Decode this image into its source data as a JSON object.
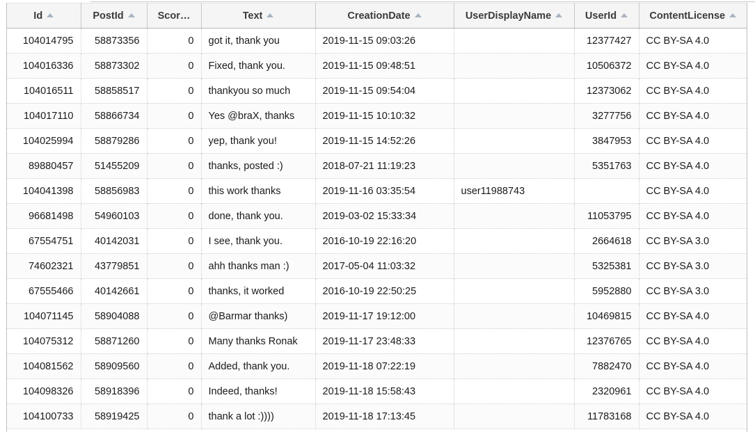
{
  "table": {
    "columns": [
      {
        "key": "id",
        "label": "Id",
        "sort": "asc",
        "align": "a-right",
        "width": 106,
        "truncated": false
      },
      {
        "key": "postid",
        "label": "PostId",
        "sort": "asc",
        "align": "a-right",
        "width": 95,
        "truncated": false
      },
      {
        "key": "score",
        "label": "Scor…",
        "sort": "none",
        "align": "a-right",
        "width": 78,
        "truncated": true
      },
      {
        "key": "text",
        "label": "Text",
        "sort": "asc",
        "align": "a-left",
        "width": 164,
        "truncated": false
      },
      {
        "key": "creationdate",
        "label": "CreationDate",
        "sort": "asc",
        "align": "a-left",
        "width": 199,
        "truncated": false
      },
      {
        "key": "userdisplayname",
        "label": "UserDisplayName",
        "sort": "asc",
        "align": "a-left",
        "width": 173,
        "truncated": false
      },
      {
        "key": "userid",
        "label": "UserId",
        "sort": "asc",
        "align": "a-right",
        "width": 93,
        "truncated": false
      },
      {
        "key": "contentlicense",
        "label": "ContentLicense",
        "sort": "asc",
        "align": "a-left",
        "width": 155,
        "truncated": false
      }
    ],
    "rows": [
      {
        "id": "104014795",
        "postid": "58873356",
        "score": "0",
        "text": "got it, thank you",
        "creationdate": "2019-11-15 09:03:26",
        "userdisplayname": "",
        "userid": "12377427",
        "contentlicense": "CC BY-SA 4.0"
      },
      {
        "id": "104016336",
        "postid": "58873302",
        "score": "0",
        "text": "Fixed, thank you.",
        "creationdate": "2019-11-15 09:48:51",
        "userdisplayname": "",
        "userid": "10506372",
        "contentlicense": "CC BY-SA 4.0"
      },
      {
        "id": "104016511",
        "postid": "58858517",
        "score": "0",
        "text": "thankyou so much",
        "creationdate": "2019-11-15 09:54:04",
        "userdisplayname": "",
        "userid": "12373062",
        "contentlicense": "CC BY-SA 4.0"
      },
      {
        "id": "104017110",
        "postid": "58866734",
        "score": "0",
        "text": "Yes @braX, thanks",
        "creationdate": "2019-11-15 10:10:32",
        "userdisplayname": "",
        "userid": "3277756",
        "contentlicense": "CC BY-SA 4.0"
      },
      {
        "id": "104025994",
        "postid": "58879286",
        "score": "0",
        "text": "yep, thank you!",
        "creationdate": "2019-11-15 14:52:26",
        "userdisplayname": "",
        "userid": "3847953",
        "contentlicense": "CC BY-SA 4.0"
      },
      {
        "id": "89880457",
        "postid": "51455209",
        "score": "0",
        "text": "thanks, posted :)",
        "creationdate": "2018-07-21 11:19:23",
        "userdisplayname": "",
        "userid": "5351763",
        "contentlicense": "CC BY-SA 4.0"
      },
      {
        "id": "104041398",
        "postid": "58856983",
        "score": "0",
        "text": "this work thanks",
        "creationdate": "2019-11-16 03:35:54",
        "userdisplayname": "user11988743",
        "userid": "",
        "contentlicense": "CC BY-SA 4.0"
      },
      {
        "id": "96681498",
        "postid": "54960103",
        "score": "0",
        "text": "done, thank you.",
        "creationdate": "2019-03-02 15:33:34",
        "userdisplayname": "",
        "userid": "11053795",
        "contentlicense": "CC BY-SA 4.0"
      },
      {
        "id": "67554751",
        "postid": "40142031",
        "score": "0",
        "text": "I see, thank you.",
        "creationdate": "2016-10-19 22:16:20",
        "userdisplayname": "",
        "userid": "2664618",
        "contentlicense": "CC BY-SA 3.0"
      },
      {
        "id": "74602321",
        "postid": "43779851",
        "score": "0",
        "text": "ahh thanks man :)",
        "creationdate": "2017-05-04 11:03:32",
        "userdisplayname": "",
        "userid": "5325381",
        "contentlicense": "CC BY-SA 3.0"
      },
      {
        "id": "67555466",
        "postid": "40142661",
        "score": "0",
        "text": "thanks, it worked",
        "creationdate": "2016-10-19 22:50:25",
        "userdisplayname": "",
        "userid": "5952880",
        "contentlicense": "CC BY-SA 3.0"
      },
      {
        "id": "104071145",
        "postid": "58904088",
        "score": "0",
        "text": "@Barmar thanks)",
        "creationdate": "2019-11-17 19:12:00",
        "userdisplayname": "",
        "userid": "10469815",
        "contentlicense": "CC BY-SA 4.0"
      },
      {
        "id": "104075312",
        "postid": "58871260",
        "score": "0",
        "text": "Many thanks Ronak",
        "creationdate": "2019-11-17 23:48:33",
        "userdisplayname": "",
        "userid": "12376765",
        "contentlicense": "CC BY-SA 4.0"
      },
      {
        "id": "104081562",
        "postid": "58909560",
        "score": "0",
        "text": "Added, thank you.",
        "creationdate": "2019-11-18 07:22:19",
        "userdisplayname": "",
        "userid": "7882470",
        "contentlicense": "CC BY-SA 4.0"
      },
      {
        "id": "104098326",
        "postid": "58918396",
        "score": "0",
        "text": "Indeed, thanks!",
        "creationdate": "2019-11-18 15:58:43",
        "userdisplayname": "",
        "userid": "2320961",
        "contentlicense": "CC BY-SA 4.0"
      },
      {
        "id": "104100733",
        "postid": "58919425",
        "score": "0",
        "text": "thank a lot :))))",
        "creationdate": "2019-11-18 17:13:45",
        "userdisplayname": "",
        "userid": "11783168",
        "contentlicense": "CC BY-SA 4.0"
      }
    ]
  },
  "colors": {
    "header_bg": "#f5f5f5",
    "header_text": "#3b3b3b",
    "cell_text": "#1a1a1a",
    "row_alt_bg": "#fbfbfb",
    "border_solid": "#c8c8c8",
    "border_dotted": "#cccccc",
    "sort_arrow": "#a9b4c0"
  }
}
